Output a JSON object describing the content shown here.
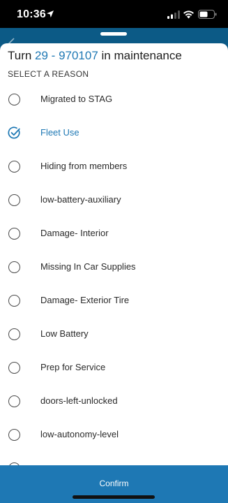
{
  "status_bar": {
    "time": "10:36"
  },
  "sheet": {
    "title_prefix": "Turn ",
    "vehicle_id": "29 - 970107",
    "title_suffix": " in maintenance",
    "section_label": "SELECT A REASON"
  },
  "reasons": [
    {
      "label": "Migrated to STAG",
      "selected": false
    },
    {
      "label": "Fleet Use",
      "selected": true
    },
    {
      "label": "Hiding from members",
      "selected": false
    },
    {
      "label": "low-battery-auxiliary",
      "selected": false
    },
    {
      "label": "Damage- Interior",
      "selected": false
    },
    {
      "label": "Missing In Car Supplies",
      "selected": false
    },
    {
      "label": "Damage- Exterior Tire",
      "selected": false
    },
    {
      "label": "Low Battery",
      "selected": false
    },
    {
      "label": "Prep for Service",
      "selected": false
    },
    {
      "label": "doors-left-unlocked",
      "selected": false
    },
    {
      "label": "low-autonomy-level",
      "selected": false
    }
  ],
  "footer": {
    "confirm_label": "Confirm"
  },
  "colors": {
    "accent": "#1e78b4",
    "backdrop": "#0c5a86"
  },
  "icons": {
    "status": [
      "location-arrow-icon",
      "signal-icon",
      "wifi-icon",
      "battery-icon"
    ],
    "selected": "checkmark-circle-icon",
    "unselected": "radio-empty-icon"
  }
}
